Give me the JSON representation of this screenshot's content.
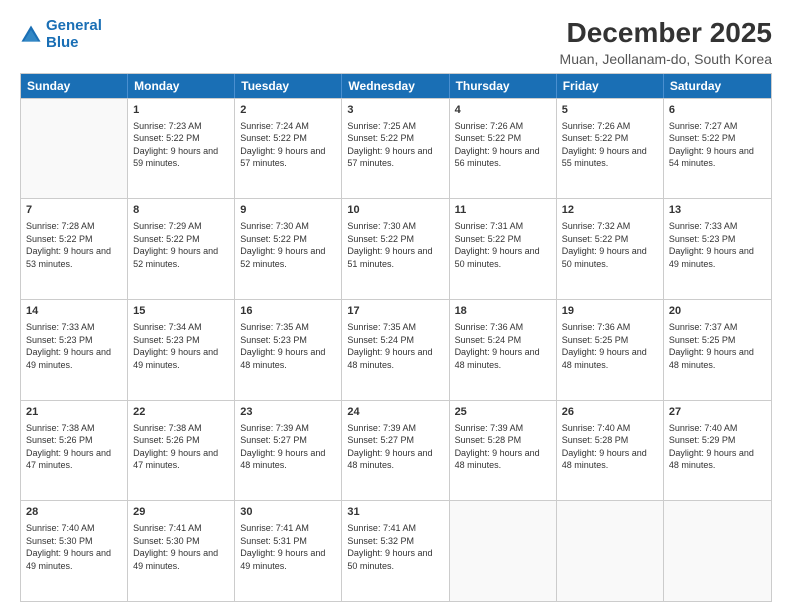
{
  "logo": {
    "line1": "General",
    "line2": "Blue"
  },
  "title": "December 2025",
  "subtitle": "Muan, Jeollanam-do, South Korea",
  "days": [
    "Sunday",
    "Monday",
    "Tuesday",
    "Wednesday",
    "Thursday",
    "Friday",
    "Saturday"
  ],
  "weeks": [
    [
      {
        "day": "",
        "sunrise": "",
        "sunset": "",
        "daylight": "",
        "empty": true
      },
      {
        "day": "1",
        "sunrise": "Sunrise: 7:23 AM",
        "sunset": "Sunset: 5:22 PM",
        "daylight": "Daylight: 9 hours and 59 minutes."
      },
      {
        "day": "2",
        "sunrise": "Sunrise: 7:24 AM",
        "sunset": "Sunset: 5:22 PM",
        "daylight": "Daylight: 9 hours and 57 minutes."
      },
      {
        "day": "3",
        "sunrise": "Sunrise: 7:25 AM",
        "sunset": "Sunset: 5:22 PM",
        "daylight": "Daylight: 9 hours and 57 minutes."
      },
      {
        "day": "4",
        "sunrise": "Sunrise: 7:26 AM",
        "sunset": "Sunset: 5:22 PM",
        "daylight": "Daylight: 9 hours and 56 minutes."
      },
      {
        "day": "5",
        "sunrise": "Sunrise: 7:26 AM",
        "sunset": "Sunset: 5:22 PM",
        "daylight": "Daylight: 9 hours and 55 minutes."
      },
      {
        "day": "6",
        "sunrise": "Sunrise: 7:27 AM",
        "sunset": "Sunset: 5:22 PM",
        "daylight": "Daylight: 9 hours and 54 minutes."
      }
    ],
    [
      {
        "day": "7",
        "sunrise": "Sunrise: 7:28 AM",
        "sunset": "Sunset: 5:22 PM",
        "daylight": "Daylight: 9 hours and 53 minutes."
      },
      {
        "day": "8",
        "sunrise": "Sunrise: 7:29 AM",
        "sunset": "Sunset: 5:22 PM",
        "daylight": "Daylight: 9 hours and 52 minutes."
      },
      {
        "day": "9",
        "sunrise": "Sunrise: 7:30 AM",
        "sunset": "Sunset: 5:22 PM",
        "daylight": "Daylight: 9 hours and 52 minutes."
      },
      {
        "day": "10",
        "sunrise": "Sunrise: 7:30 AM",
        "sunset": "Sunset: 5:22 PM",
        "daylight": "Daylight: 9 hours and 51 minutes."
      },
      {
        "day": "11",
        "sunrise": "Sunrise: 7:31 AM",
        "sunset": "Sunset: 5:22 PM",
        "daylight": "Daylight: 9 hours and 50 minutes."
      },
      {
        "day": "12",
        "sunrise": "Sunrise: 7:32 AM",
        "sunset": "Sunset: 5:22 PM",
        "daylight": "Daylight: 9 hours and 50 minutes."
      },
      {
        "day": "13",
        "sunrise": "Sunrise: 7:33 AM",
        "sunset": "Sunset: 5:23 PM",
        "daylight": "Daylight: 9 hours and 49 minutes."
      }
    ],
    [
      {
        "day": "14",
        "sunrise": "Sunrise: 7:33 AM",
        "sunset": "Sunset: 5:23 PM",
        "daylight": "Daylight: 9 hours and 49 minutes."
      },
      {
        "day": "15",
        "sunrise": "Sunrise: 7:34 AM",
        "sunset": "Sunset: 5:23 PM",
        "daylight": "Daylight: 9 hours and 49 minutes."
      },
      {
        "day": "16",
        "sunrise": "Sunrise: 7:35 AM",
        "sunset": "Sunset: 5:23 PM",
        "daylight": "Daylight: 9 hours and 48 minutes."
      },
      {
        "day": "17",
        "sunrise": "Sunrise: 7:35 AM",
        "sunset": "Sunset: 5:24 PM",
        "daylight": "Daylight: 9 hours and 48 minutes."
      },
      {
        "day": "18",
        "sunrise": "Sunrise: 7:36 AM",
        "sunset": "Sunset: 5:24 PM",
        "daylight": "Daylight: 9 hours and 48 minutes."
      },
      {
        "day": "19",
        "sunrise": "Sunrise: 7:36 AM",
        "sunset": "Sunset: 5:25 PM",
        "daylight": "Daylight: 9 hours and 48 minutes."
      },
      {
        "day": "20",
        "sunrise": "Sunrise: 7:37 AM",
        "sunset": "Sunset: 5:25 PM",
        "daylight": "Daylight: 9 hours and 48 minutes."
      }
    ],
    [
      {
        "day": "21",
        "sunrise": "Sunrise: 7:38 AM",
        "sunset": "Sunset: 5:26 PM",
        "daylight": "Daylight: 9 hours and 47 minutes."
      },
      {
        "day": "22",
        "sunrise": "Sunrise: 7:38 AM",
        "sunset": "Sunset: 5:26 PM",
        "daylight": "Daylight: 9 hours and 47 minutes."
      },
      {
        "day": "23",
        "sunrise": "Sunrise: 7:39 AM",
        "sunset": "Sunset: 5:27 PM",
        "daylight": "Daylight: 9 hours and 48 minutes."
      },
      {
        "day": "24",
        "sunrise": "Sunrise: 7:39 AM",
        "sunset": "Sunset: 5:27 PM",
        "daylight": "Daylight: 9 hours and 48 minutes."
      },
      {
        "day": "25",
        "sunrise": "Sunrise: 7:39 AM",
        "sunset": "Sunset: 5:28 PM",
        "daylight": "Daylight: 9 hours and 48 minutes."
      },
      {
        "day": "26",
        "sunrise": "Sunrise: 7:40 AM",
        "sunset": "Sunset: 5:28 PM",
        "daylight": "Daylight: 9 hours and 48 minutes."
      },
      {
        "day": "27",
        "sunrise": "Sunrise: 7:40 AM",
        "sunset": "Sunset: 5:29 PM",
        "daylight": "Daylight: 9 hours and 48 minutes."
      }
    ],
    [
      {
        "day": "28",
        "sunrise": "Sunrise: 7:40 AM",
        "sunset": "Sunset: 5:30 PM",
        "daylight": "Daylight: 9 hours and 49 minutes."
      },
      {
        "day": "29",
        "sunrise": "Sunrise: 7:41 AM",
        "sunset": "Sunset: 5:30 PM",
        "daylight": "Daylight: 9 hours and 49 minutes."
      },
      {
        "day": "30",
        "sunrise": "Sunrise: 7:41 AM",
        "sunset": "Sunset: 5:31 PM",
        "daylight": "Daylight: 9 hours and 49 minutes."
      },
      {
        "day": "31",
        "sunrise": "Sunrise: 7:41 AM",
        "sunset": "Sunset: 5:32 PM",
        "daylight": "Daylight: 9 hours and 50 minutes."
      },
      {
        "day": "",
        "sunrise": "",
        "sunset": "",
        "daylight": "",
        "empty": true
      },
      {
        "day": "",
        "sunrise": "",
        "sunset": "",
        "daylight": "",
        "empty": true
      },
      {
        "day": "",
        "sunrise": "",
        "sunset": "",
        "daylight": "",
        "empty": true
      }
    ]
  ]
}
